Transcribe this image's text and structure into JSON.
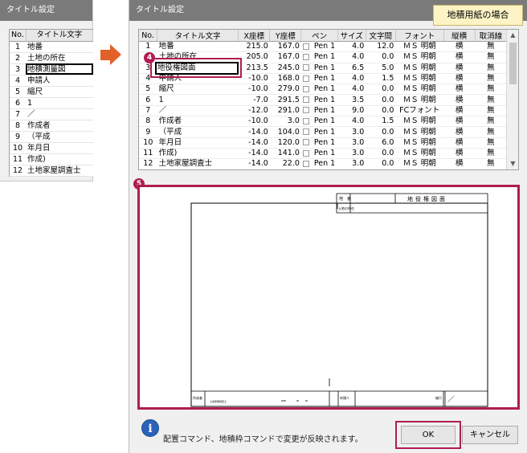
{
  "left_dialog": {
    "title": "タイトル設定",
    "headers": [
      "No.",
      "タイトル文字"
    ],
    "rows": [
      [
        "1",
        "地番"
      ],
      [
        "2",
        "土地の所在"
      ],
      [
        "3",
        "地積測量図"
      ],
      [
        "4",
        "申請人"
      ],
      [
        "5",
        "縮尺"
      ],
      [
        "6",
        "1"
      ],
      [
        "7",
        "／"
      ],
      [
        "8",
        "作成者"
      ],
      [
        "9",
        "（平成"
      ],
      [
        "10",
        "年月日"
      ],
      [
        "11",
        "作成)"
      ],
      [
        "12",
        "土地家屋調査士"
      ]
    ]
  },
  "main_dialog": {
    "title": "タイトル設定",
    "note": "地積用紙の場合",
    "headers": [
      "No.",
      "タイトル文字",
      "X座標",
      "Y座標",
      "ペン",
      "サイズ",
      "文字間",
      "フォント",
      "縦横",
      "取消線"
    ],
    "rows": [
      [
        "1",
        "地番",
        "215.0",
        "167.0",
        "Pen 1",
        "4.0",
        "12.0",
        "ＭＳ 明朝",
        "横",
        "無"
      ],
      [
        "2",
        "土地の所在",
        "205.0",
        "167.0",
        "Pen 1",
        "4.0",
        "0.0",
        "ＭＳ 明朝",
        "横",
        "無"
      ],
      [
        "3",
        "地積測量図",
        "213.5",
        "245.0",
        "Pen 1",
        "6.5",
        "5.0",
        "ＭＳ 明朝",
        "横",
        "無"
      ],
      [
        "4",
        "申請人",
        "-10.0",
        "168.0",
        "Pen 1",
        "4.0",
        "1.5",
        "ＭＳ 明朝",
        "横",
        "無"
      ],
      [
        "5",
        "縮尺",
        "-10.0",
        "279.0",
        "Pen 1",
        "4.0",
        "0.0",
        "ＭＳ 明朝",
        "横",
        "無"
      ],
      [
        "6",
        "1",
        "-7.0",
        "291.5",
        "Pen 1",
        "3.5",
        "0.0",
        "ＭＳ 明朝",
        "横",
        "無"
      ],
      [
        "7",
        "／",
        "-12.0",
        "291.0",
        "Pen 1",
        "9.0",
        "0.0",
        "FCフォント",
        "横",
        "無"
      ],
      [
        "8",
        "作成者",
        "-10.0",
        "3.0",
        "Pen 1",
        "4.0",
        "1.5",
        "ＭＳ 明朝",
        "横",
        "無"
      ],
      [
        "9",
        "（平成",
        "-14.0",
        "104.0",
        "Pen 1",
        "3.0",
        "0.0",
        "ＭＳ 明朝",
        "横",
        "無"
      ],
      [
        "10",
        "年月日",
        "-14.0",
        "120.0",
        "Pen 1",
        "3.0",
        "6.0",
        "ＭＳ 明朝",
        "横",
        "無"
      ],
      [
        "11",
        "作成)",
        "-14.0",
        "141.0",
        "Pen 1",
        "3.0",
        "0.0",
        "ＭＳ 明朝",
        "横",
        "無"
      ],
      [
        "12",
        "土地家屋調査士",
        "-14.0",
        "22.0",
        "Pen 1",
        "3.0",
        "0.0",
        "ＭＳ 明朝",
        "横",
        "無"
      ]
    ],
    "edit_value": "地役権図面",
    "badge_4": "4",
    "badge_5": "5",
    "preview": {
      "title_text": "地役権図面",
      "label_chiban": "地　番",
      "label_shozai": "土地の所在",
      "label_sakuseisha": "作成者",
      "label_shinseinin": "申請人",
      "label_shukushaku": "縮尺",
      "sakusei_detail": "土地家屋調査士",
      "slash": "／"
    },
    "info_text": "配置コマンド、地積枠コマンドで変更が反映されます。",
    "ok_label": "OK",
    "cancel_label": "キャンセル",
    "accent_color": "#b01c52",
    "arrow_color": "#e2602a"
  }
}
